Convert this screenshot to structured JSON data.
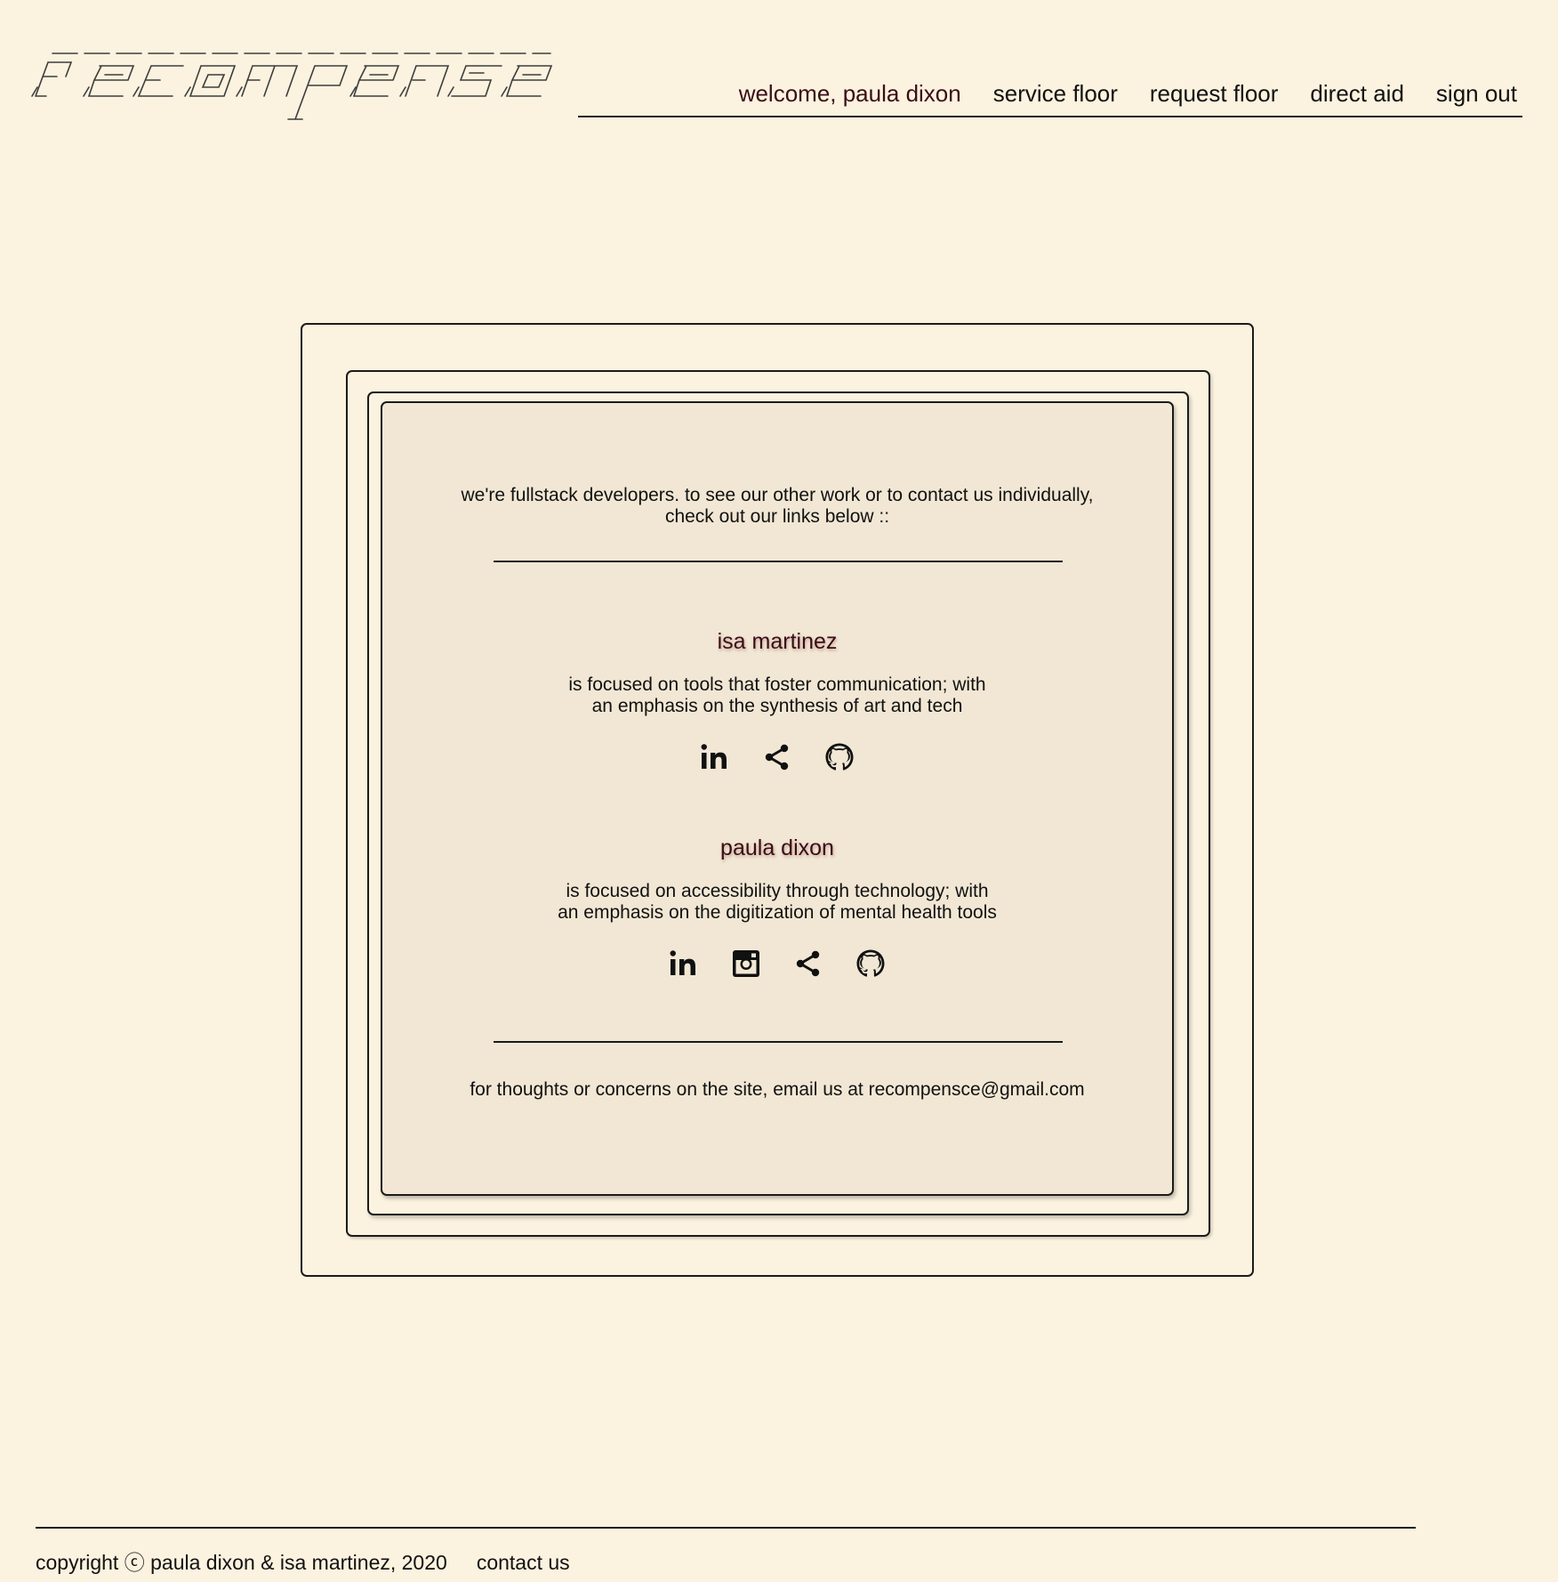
{
  "header": {
    "logo_text": "recompense",
    "nav": {
      "welcome": "welcome, paula dixon",
      "service_floor": "service floor",
      "request_floor": "request floor",
      "direct_aid": "direct aid",
      "sign_out": "sign out"
    }
  },
  "card": {
    "intro": "we're fullstack developers. to see our other work or to contact us individually,\ncheck out our links below ::",
    "developers": [
      {
        "name": "isa martinez",
        "description": "is focused on tools that foster communication; with\nan emphasis on the synthesis of art and tech",
        "links": [
          "linkedin-icon",
          "share-icon",
          "github-icon"
        ]
      },
      {
        "name": "paula dixon",
        "description": "is focused on accessibility through technology; with\nan emphasis on the digitization of mental health tools",
        "links": [
          "linkedin-icon",
          "instagram-icon",
          "share-icon",
          "github-icon"
        ]
      }
    ],
    "contact": "for thoughts or concerns on the site, email us at recompensce@gmail.com"
  },
  "footer": {
    "copyright": "copyright ⓒ paula dixon & isa martinez, 2020",
    "contact_link": "contact us"
  },
  "colors": {
    "background": "#fbf2df",
    "card_background": "#f1e7d4",
    "accent_text": "#3a0d18",
    "lines": "#1b1b1b"
  }
}
